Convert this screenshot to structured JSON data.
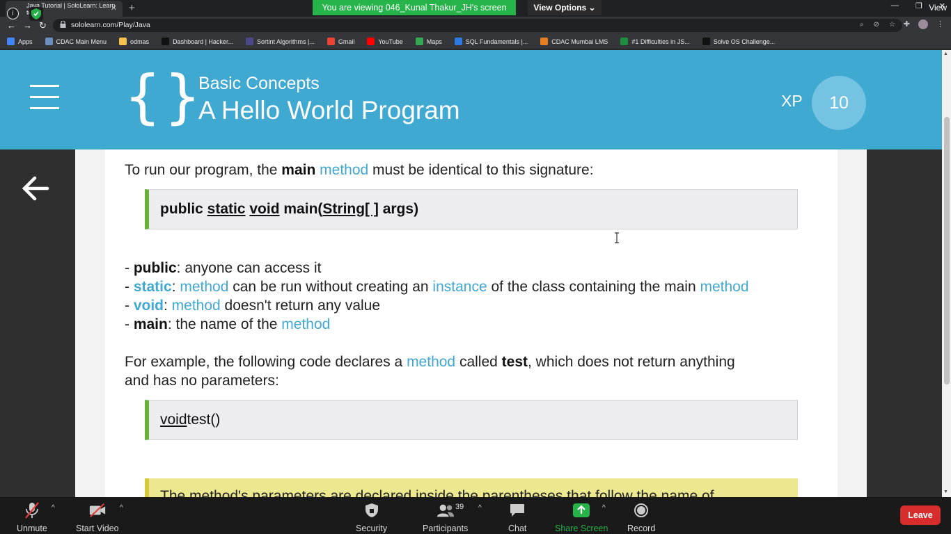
{
  "browser": {
    "tab_title": "Java Tutorial | SoloLearn: Learn to...",
    "url": "sololearn.com/Play/Java",
    "window_right_label": "View",
    "bookmarks": [
      {
        "label": "Apps",
        "color": "#4285f4"
      },
      {
        "label": "CDAC Main Menu",
        "color": "#6b8fbf"
      },
      {
        "label": "odmas",
        "color": "#f2c14e"
      },
      {
        "label": "Dashboard | Hacker...",
        "color": "#111111"
      },
      {
        "label": "Sortint Algorithms |...",
        "color": "#4a4a8a"
      },
      {
        "label": "Gmail",
        "color": "#ea4335"
      },
      {
        "label": "YouTube",
        "color": "#ff0000"
      },
      {
        "label": "Maps",
        "color": "#34a853"
      },
      {
        "label": "SQL Fundamentals |...",
        "color": "#2a7ae2"
      },
      {
        "label": "CDAC Mumbai LMS",
        "color": "#e87f1e"
      },
      {
        "label": "#1 Difficulties in JS...",
        "color": "#1e8e3e"
      },
      {
        "label": "Solve OS Challenge...",
        "color": "#111111"
      }
    ]
  },
  "zoom_banner": {
    "viewing_text": "You are viewing 046_Kunal Thakur_JH's screen",
    "view_options": "View Options"
  },
  "lesson": {
    "course": "Basic Concepts",
    "title": "A Hello World Program",
    "xp_label": "XP",
    "xp_value": "10"
  },
  "content": {
    "intro": {
      "pre": "To run our program, the ",
      "b1": "main",
      "k1": "method",
      "post": " must be identical to this signature:"
    },
    "signature": {
      "p1": "public ",
      "u1": "static",
      "sp1": " ",
      "u2": "void",
      "p2": " main(",
      "u3": "String[ ]",
      "p3": " args)"
    },
    "bullets": [
      {
        "dash": "- ",
        "key": "public",
        "rest": ": anyone can access it"
      },
      {
        "dash": "- ",
        "key": "static",
        "sep": ": ",
        "k1": "method",
        "mid": " can be run without creating an ",
        "k2": "instance",
        "mid2": " of the class containing the main ",
        "k3": "method"
      },
      {
        "dash": "- ",
        "key": "void",
        "sep": ": ",
        "k1": "method",
        "rest": " doesn't return any value"
      },
      {
        "dash": "- ",
        "key": "main",
        "rest": ": the name of the ",
        "k1": "method"
      }
    ],
    "example": {
      "pre": "For example, the following code declares a ",
      "k1": "method",
      "mid": " called ",
      "b1": "test",
      "post": ", which does not return anything",
      "line2": "and has no parameters:"
    },
    "code2": {
      "u1": "void",
      "rest": " test()"
    },
    "note": "The method's parameters are declared inside the parentheses that follow the name of"
  },
  "zoom_toolbar": {
    "unmute": "Unmute",
    "start_video": "Start Video",
    "security": "Security",
    "participants": "Participants",
    "participants_count": "39",
    "chat": "Chat",
    "share_screen": "Share Screen",
    "record": "Record",
    "leave": "Leave"
  },
  "colors": {
    "accent": "#3fa9d2",
    "code_border": "#6ab13a",
    "leave": "#d82d2d",
    "share": "#26b34a"
  }
}
